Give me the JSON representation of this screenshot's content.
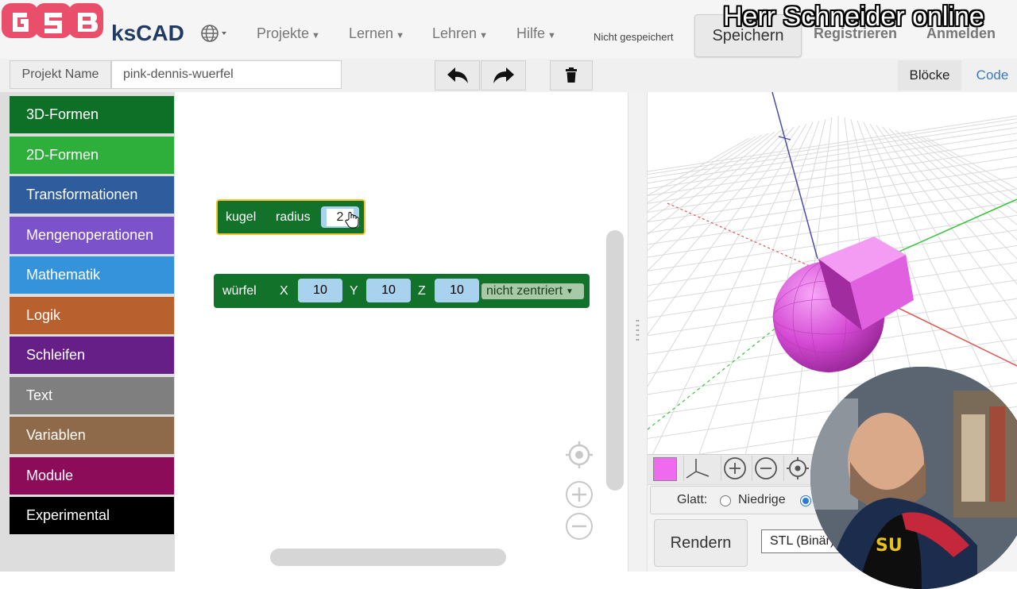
{
  "navbar": {
    "brand": "ksCAD",
    "menu": [
      {
        "label": "Projekte"
      },
      {
        "label": "Lernen"
      },
      {
        "label": "Lehren"
      },
      {
        "label": "Hilfe"
      }
    ],
    "unsaved_status": "Nicht gespeichert",
    "save_label": "Speichern",
    "register_label": "Registrieren",
    "login_label": "Anmelden",
    "language_icon": "globe-icon",
    "watermark": "Herr Schneider online"
  },
  "toolbar": {
    "project_label": "Projekt Name",
    "project_name": "pink-dennis-wuerfel",
    "undo_icon": "undo-arrow-icon",
    "redo_icon": "redo-arrow-icon",
    "trash_icon": "trash-icon",
    "tabs": [
      {
        "label": "Blöcke",
        "active": true
      },
      {
        "label": "Code",
        "active": false
      }
    ]
  },
  "categories": [
    {
      "label": "3D-Formen",
      "color": "#0e7027"
    },
    {
      "label": "2D-Formen",
      "color": "#2eae3a"
    },
    {
      "label": "Transformationen",
      "color": "#2f5c9d"
    },
    {
      "label": "Mengenoperationen",
      "color": "#7b52c9"
    },
    {
      "label": "Mathematik",
      "color": "#3593dc"
    },
    {
      "label": "Logik",
      "color": "#b8612f"
    },
    {
      "label": "Schleifen",
      "color": "#651f87"
    },
    {
      "label": "Text",
      "color": "#7f7f7f"
    },
    {
      "label": "Variablen",
      "color": "#8e6a4a"
    },
    {
      "label": "Module",
      "color": "#8c0c5a"
    },
    {
      "label": "Experimental",
      "color": "#000000"
    }
  ],
  "blocks": {
    "sphere": {
      "name": "kugel",
      "param_label": "radius",
      "radius": "2"
    },
    "cube": {
      "name": "würfel",
      "x_label": "X",
      "x": "10",
      "y_label": "Y",
      "y": "10",
      "z_label": "Z",
      "z": "10",
      "center_option": "nicht zentriert"
    }
  },
  "viewer": {
    "object_color": "#f06af0",
    "smooth_label": "Glatt:",
    "smooth_option_low": "Niedrige",
    "render_label": "Rendern",
    "export_format": "STL (Binär)"
  }
}
